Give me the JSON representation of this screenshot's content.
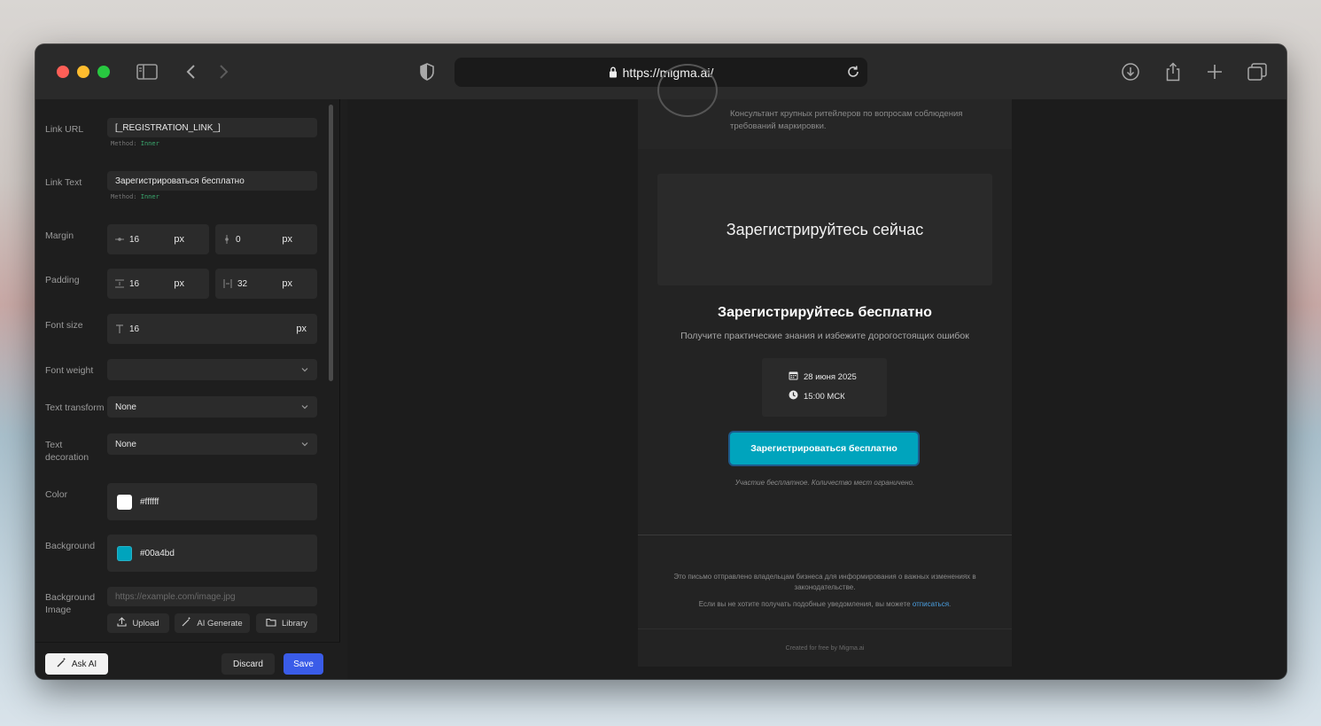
{
  "browser": {
    "url": "https://migma.ai/"
  },
  "panel": {
    "link_url": {
      "label": "Link URL",
      "value": "[_REGISTRATION_LINK_]",
      "hint_prefix": "Method:",
      "hint_method": "Inner"
    },
    "link_text": {
      "label": "Link Text",
      "value": "Зарегистрироваться бесплатно",
      "hint_prefix": "Method:",
      "hint_method": "Inner"
    },
    "margin": {
      "label": "Margin",
      "vertical": "16",
      "horizontal": "0",
      "unit": "px"
    },
    "padding": {
      "label": "Padding",
      "vertical": "16",
      "horizontal": "32",
      "unit": "px"
    },
    "font_size": {
      "label": "Font size",
      "value": "16",
      "unit": "px"
    },
    "font_weight": {
      "label": "Font weight",
      "value": ""
    },
    "text_transform": {
      "label": "Text transform",
      "value": "None"
    },
    "text_decoration": {
      "label": "Text decoration",
      "value": "None"
    },
    "color": {
      "label": "Color",
      "value": "#ffffff"
    },
    "background": {
      "label": "Background",
      "value": "#00a4bd"
    },
    "background_image": {
      "label": "Background Image",
      "placeholder": "https://example.com/image.jpg",
      "upload": "Upload",
      "ai_generate": "AI Generate",
      "library": "Library"
    },
    "actions": {
      "ask_ai": "Ask AI",
      "discard": "Discard",
      "save": "Save"
    }
  },
  "email": {
    "bio": "Консультант крупных ритейлеров по вопросам соблюдения требований маркировки.",
    "hero_title": "Зарегистрируйтесь сейчас",
    "heading": "Зарегистрируйтесь бесплатно",
    "subheading": "Получите практические знания и избежите дорогостоящих ошибок",
    "date": "28 июня 2025",
    "time": "15:00 МСК",
    "cta": "Зарегистрироваться бесплатно",
    "note": "Участие бесплатное. Количество мест ограничено.",
    "footer_text": "Это письмо отправлено владельцам бизнеса для информирования о важных изменениях в законодательстве.",
    "footer_unsubscribe_prefix": "Если вы не хотите получать подобные уведомления, вы можете",
    "footer_unsubscribe_link": "отписаться",
    "credit": "Created for free by Migma.ai"
  }
}
